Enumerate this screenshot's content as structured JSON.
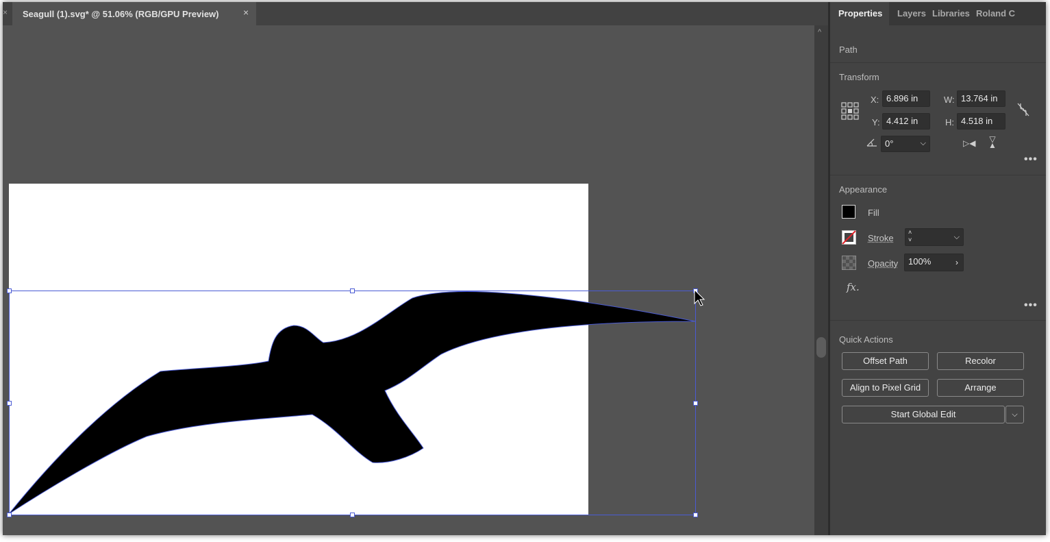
{
  "document": {
    "left_close": "×",
    "tab_title": "Seagull (1).svg* @ 51.06% (RGB/GPU Preview)",
    "tab_close": "×"
  },
  "panel": {
    "tabs": [
      "Properties",
      "Layers",
      "Libraries",
      "Roland C"
    ],
    "selection_type": "Path",
    "transform": {
      "title": "Transform",
      "x_label": "X:",
      "x_value": "6.896 in",
      "y_label": "Y:",
      "y_value": "4.412 in",
      "w_label": "W:",
      "w_value": "13.764 in",
      "h_label": "H:",
      "h_value": "4.518 in",
      "angle_value": "0°"
    },
    "appearance": {
      "title": "Appearance",
      "fill_label": "Fill",
      "fill_color": "#000000",
      "stroke_label": "Stroke",
      "opacity_label": "Opacity",
      "opacity_value": "100%",
      "fx_label": "fx."
    },
    "quick_actions": {
      "title": "Quick Actions",
      "offset_path": "Offset Path",
      "recolor": "Recolor",
      "align_pixel_grid": "Align to Pixel Grid",
      "arrange": "Arrange",
      "start_global_edit": "Start Global Edit"
    }
  },
  "colors": {
    "selection": "#4a5bd4",
    "canvas_bg": "#535353",
    "panel_bg": "#434343"
  }
}
